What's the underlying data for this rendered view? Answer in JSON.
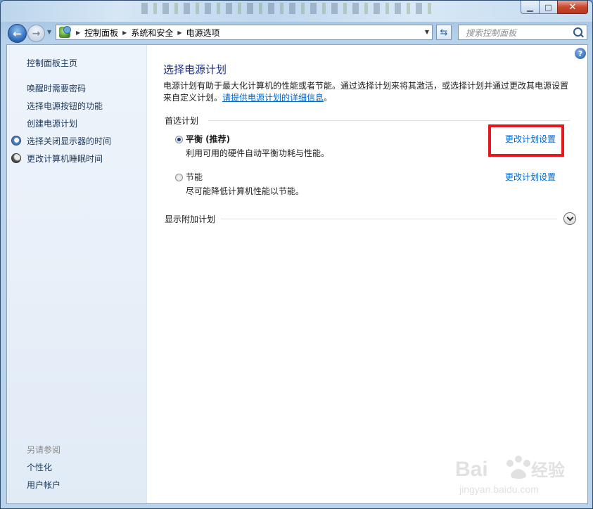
{
  "window": {
    "controls": {
      "minimize_icon": "minimize-icon",
      "maximize_icon": "maximize-icon",
      "close_icon": "close-icon"
    }
  },
  "address_bar": {
    "crumbs": [
      "控制面板",
      "系统和安全",
      "电源选项"
    ],
    "search_placeholder": "搜索控制面板"
  },
  "sidebar": {
    "home": "控制面板主页",
    "links": [
      "唤醒时需要密码",
      "选择电源按钮的功能",
      "创建电源计划",
      "选择关闭显示器的时间",
      "更改计算机睡眠时间"
    ],
    "see_also_title": "另请参阅",
    "see_also": [
      "个性化",
      "用户帐户"
    ]
  },
  "main": {
    "title": "选择电源计划",
    "description": "电源计划有助于最大化计算机的性能或者节能。通过选择计划来将其激活，或选择计划并通过更改其电源设置来自定义计划。",
    "info_link": "请提供电源计划的详细信息",
    "info_link_suffix": "。",
    "preferred_label": "首选计划",
    "plans": [
      {
        "name": "平衡 (推荐)",
        "description": "利用可用的硬件自动平衡功耗与性能。",
        "change_link": "更改计划设置",
        "selected": true
      },
      {
        "name": "节能",
        "description": "尽可能降低计算机性能以节能。",
        "change_link": "更改计划设置",
        "selected": false
      }
    ],
    "show_additional": "显示附加计划"
  },
  "watermark": {
    "brand": "Bai",
    "brand2": "经验",
    "url": "jingyan.baidu.com"
  },
  "colors": {
    "accent_link": "#0066cc",
    "title": "#1e3287",
    "highlight": "#e8191c"
  }
}
